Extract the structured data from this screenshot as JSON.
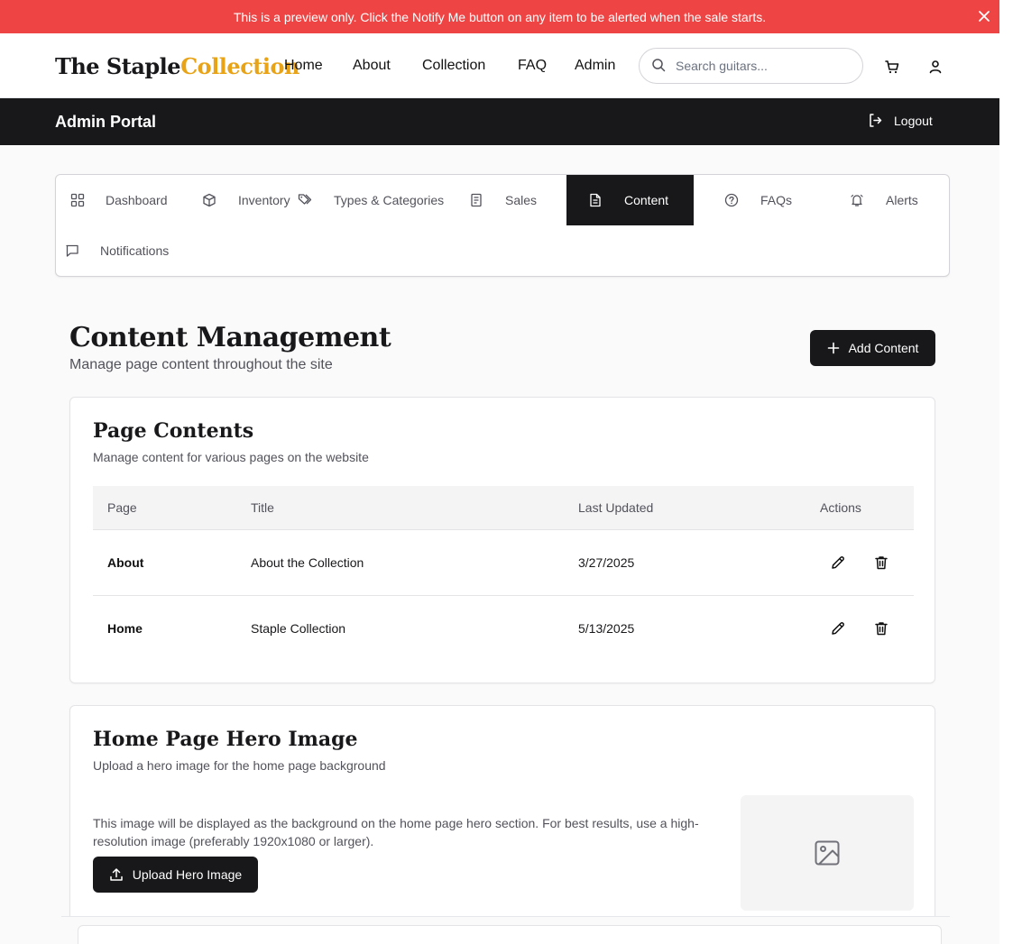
{
  "banner": {
    "text": "This is a preview only. Click the Notify Me button on any item to be alerted when the sale starts.",
    "close_icon": "close-icon",
    "color": "#ef4444"
  },
  "header": {
    "logo_part1": "The Staple",
    "logo_part2": "Collection",
    "logo_accent_color": "#e8a317",
    "nav": [
      "Home",
      "About",
      "Collection",
      "FAQ",
      "Admin"
    ],
    "search_placeholder": "Search guitars...",
    "cart_icon": "cart-icon",
    "user_icon": "user-icon"
  },
  "admin_bar": {
    "title": "Admin Portal",
    "logout_label": "Logout"
  },
  "tabs": [
    {
      "label": "Dashboard",
      "icon": "grid-icon",
      "active": false
    },
    {
      "label": "Inventory",
      "icon": "package-icon",
      "active": false
    },
    {
      "label": "Types & Categories",
      "icon": "tags-icon",
      "active": false
    },
    {
      "label": "Sales",
      "icon": "receipt-icon",
      "active": false
    },
    {
      "label": "Content",
      "icon": "file-text-icon",
      "active": true
    },
    {
      "label": "FAQs",
      "icon": "help-circle-icon",
      "active": false
    },
    {
      "label": "Alerts",
      "icon": "bell-icon",
      "active": false
    },
    {
      "label": "Notifications",
      "icon": "message-square-icon",
      "active": false
    }
  ],
  "content": {
    "title": "Content Management",
    "subtitle": "Manage page content throughout the site",
    "add_button": "Add Content"
  },
  "page_contents": {
    "title": "Page Contents",
    "description": "Manage content for various pages on the website",
    "columns": [
      "Page",
      "Title",
      "Last Updated",
      "Actions"
    ],
    "rows": [
      {
        "page": "About",
        "title": "About the Collection",
        "updated": "3/27/2025"
      },
      {
        "page": "Home",
        "title": "Staple Collection",
        "updated": "5/13/2025"
      }
    ]
  },
  "hero": {
    "title": "Home Page Hero Image",
    "description": "Upload a hero image for the home page background",
    "info": "This image will be displayed as the background on the home page hero section. For best results, use a high-resolution image (preferably 1920x1080 or larger).",
    "upload_button": "Upload Hero Image",
    "placeholder_icon": "image-icon"
  }
}
